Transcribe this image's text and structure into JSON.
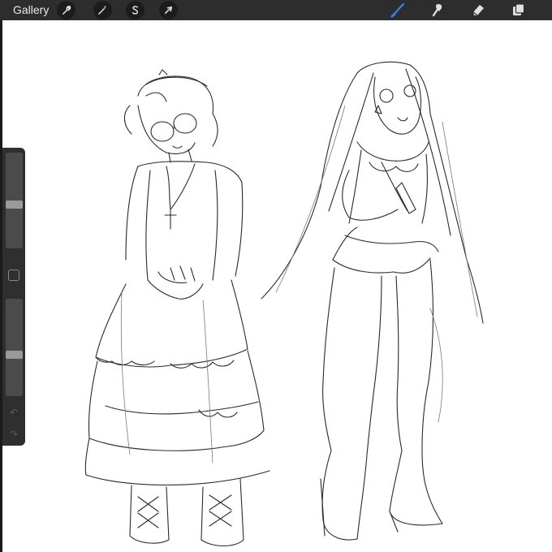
{
  "topbar": {
    "gallery_label": "Gallery",
    "left_tools": [
      {
        "icon": "wrench-icon",
        "name": "actions"
      },
      {
        "icon": "magic-wand-icon",
        "name": "adjustments"
      },
      {
        "icon": "selection-s-icon",
        "name": "selection"
      },
      {
        "icon": "arrow-cursor-icon",
        "name": "transform"
      }
    ],
    "right_tools": [
      {
        "icon": "brush-icon",
        "name": "paint",
        "active": true
      },
      {
        "icon": "smudge-icon",
        "name": "smudge"
      },
      {
        "icon": "eraser-icon",
        "name": "eraser"
      },
      {
        "icon": "layers-icon",
        "name": "layers"
      }
    ]
  },
  "sidebar": {
    "brush_size_level": 0.45,
    "brush_opacity_level": 0.42,
    "undo_icon": "undo-icon",
    "redo_icon": "redo-icon"
  },
  "colors": {
    "toolbar": "#2d2d2d",
    "accent_active": "#3d7ff0",
    "canvas": "#ffffff"
  }
}
